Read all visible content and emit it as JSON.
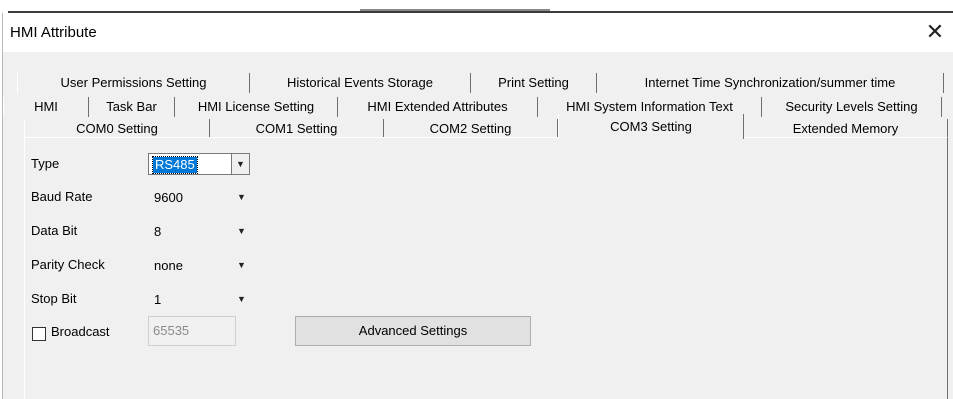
{
  "window": {
    "title": "HMI Attribute",
    "close_glyph": "✕"
  },
  "tabs": {
    "row1": [
      "User Permissions Setting",
      "Historical Events Storage",
      "Print Setting",
      "Internet Time Synchronization/summer time"
    ],
    "row2": [
      "HMI",
      "Task Bar",
      "HMI License Setting",
      "HMI Extended Attributes",
      "HMI System Information Text",
      "Security Levels Setting"
    ],
    "row3": [
      "COM0 Setting",
      "COM1 Setting",
      "COM2 Setting",
      "COM3 Setting",
      "Extended Memory"
    ],
    "active": "COM3 Setting"
  },
  "form": {
    "type": {
      "label": "Type",
      "value": "RS485"
    },
    "baud_rate": {
      "label": "Baud Rate",
      "value": "9600"
    },
    "data_bit": {
      "label": "Data Bit",
      "value": "8"
    },
    "parity_check": {
      "label": "Parity Check",
      "value": "none"
    },
    "stop_bit": {
      "label": "Stop Bit",
      "value": "1"
    },
    "broadcast": {
      "label": "Broadcast",
      "checked": false,
      "value": "65535"
    },
    "advanced_button": "Advanced Settings"
  },
  "icons": {
    "dropdown_arrow": "▼"
  }
}
